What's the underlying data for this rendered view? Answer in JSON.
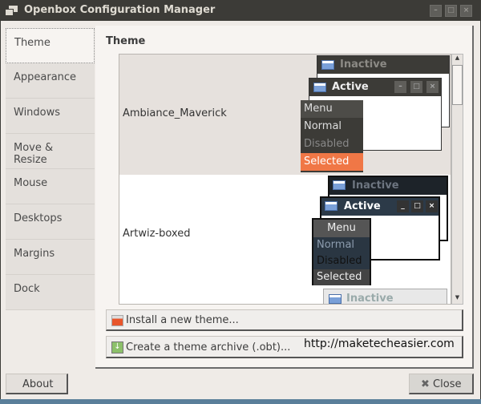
{
  "window": {
    "title": "Openbox Configuration Manager"
  },
  "sidebar": {
    "items": [
      {
        "label": "Theme"
      },
      {
        "label": "Appearance"
      },
      {
        "label": "Windows"
      },
      {
        "label": "Move & Resize"
      },
      {
        "label": "Mouse"
      },
      {
        "label": "Desktops"
      },
      {
        "label": "Margins"
      },
      {
        "label": "Dock"
      }
    ]
  },
  "main": {
    "heading": "Theme",
    "themes": [
      {
        "name": "Ambiance_Maverick"
      },
      {
        "name": "Artwiz-boxed"
      }
    ],
    "preview": {
      "inactive": "Inactive",
      "active": "Active",
      "menu": "Menu",
      "normal": "Normal",
      "disabled": "Disabled",
      "selected": "Selected"
    },
    "install_button": "Install a new theme...",
    "archive_button": "Create a theme archive (.obt)..."
  },
  "watermark": "http://maketecheasier.com",
  "footer": {
    "about": "About",
    "close": "Close"
  },
  "colors": {
    "selected_orange": "#f07746",
    "titlebar": "#3c3b37"
  }
}
